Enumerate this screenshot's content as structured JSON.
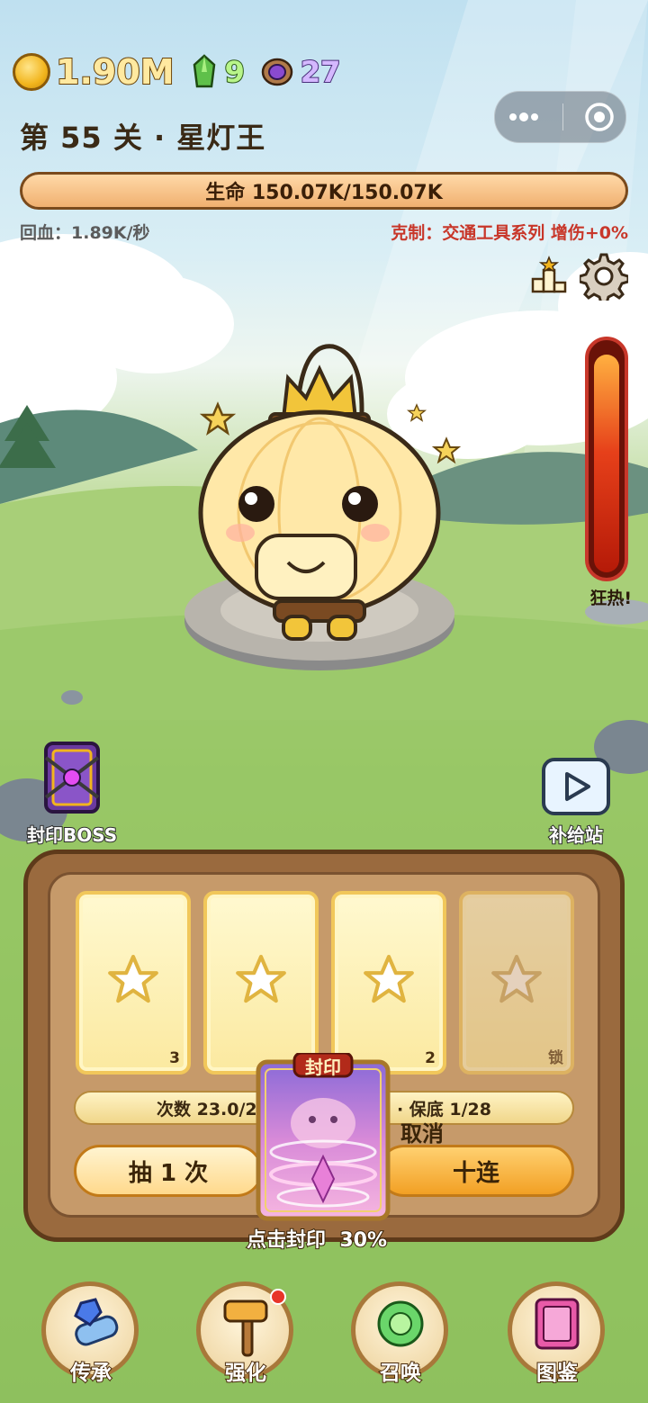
{
  "resources": {
    "gold": "1.90M",
    "green_gems": "9",
    "purple_gems": "27"
  },
  "level": {
    "title": "第 55 关 · 星灯王"
  },
  "boss": {
    "hp_text": "生命 150.07K/150.07K",
    "hp_fraction": 1.0,
    "regen_text": "回血：1.89K/秒",
    "counter_text": "克制：交通工具系列 增伤+0%"
  },
  "rage": {
    "label": "狂热!",
    "fill_fraction": 0.96
  },
  "side_buttons": {
    "seal_boss": "封印BOSS",
    "supply_station": "补给站"
  },
  "cards": [
    {
      "badge": "3",
      "locked": false
    },
    {
      "badge": "",
      "locked": false
    },
    {
      "badge": "2",
      "locked": false
    },
    {
      "badge": "锁",
      "locked": true
    }
  ],
  "draw": {
    "count_text": "次数 23.0/2",
    "pity_text": "· 保底 1/28",
    "draw_one": "抽 1 次",
    "draw_ten": "十连",
    "cancel": "取消"
  },
  "seal": {
    "card_title": "封印",
    "hint": "点击封印",
    "percent": "30%"
  },
  "nav": [
    {
      "label": "传承",
      "icon": "scroll-gem-icon"
    },
    {
      "label": "强化",
      "icon": "hammer-icon",
      "dot": true
    },
    {
      "label": "召唤",
      "icon": "summon-orb-icon"
    },
    {
      "label": "图鉴",
      "icon": "book-icon"
    }
  ],
  "colors": {
    "accent_red": "#c8372a",
    "panel_wood": "#9a6a3e",
    "card_gold": "#f1c75a"
  }
}
